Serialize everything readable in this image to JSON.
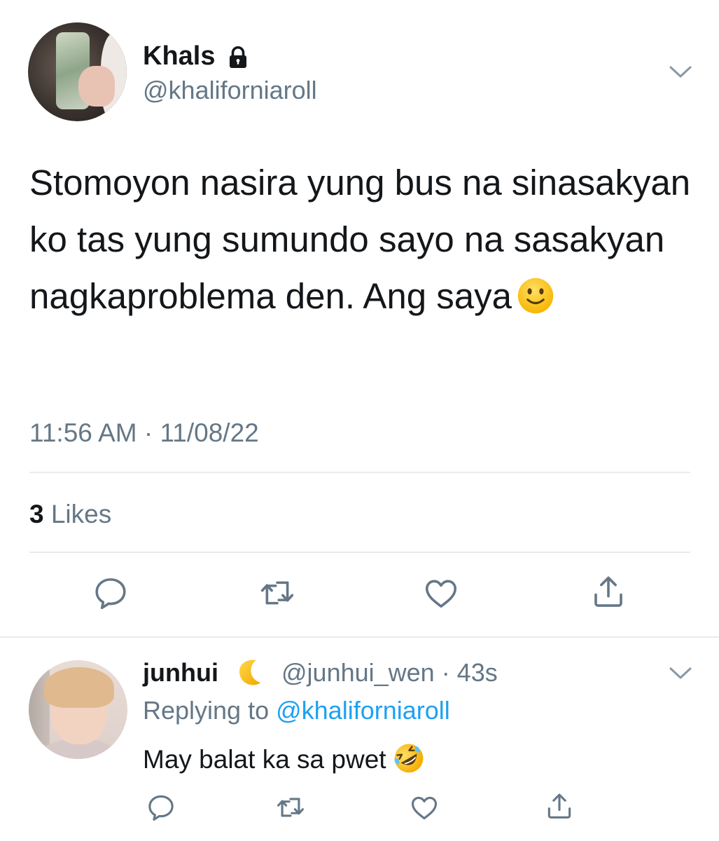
{
  "main_tweet": {
    "display_name": "Khals",
    "handle": "@khaliforniaroll",
    "text": "Stomoyon nasira yung bus na sinasakyan ko tas yung sumundo sayo na sasakyan nagkaproblema den. Ang saya",
    "text_emoji": "slightly-smiling-face-icon",
    "timestamp": "11:56 AM · 11/08/22",
    "likes_count": "3",
    "likes_label": "Likes",
    "icons": {
      "lock": "lock-icon",
      "menu": "chevron-down-icon",
      "actions": [
        "reply-icon",
        "retweet-icon",
        "like-icon",
        "share-icon"
      ]
    }
  },
  "reply": {
    "display_name": "junhui",
    "name_emoji": "crescent-moon-icon",
    "handle_time": "@junhui_wen · 43s",
    "replying_prefix": "Replying to ",
    "replying_handle": "@khaliforniaroll",
    "text": "May balat ka sa pwet",
    "text_emoji": "rolling-on-floor-laughing-icon",
    "icons": {
      "menu": "chevron-down-icon",
      "actions": [
        "reply-icon",
        "retweet-icon",
        "like-icon",
        "share-icon"
      ]
    }
  },
  "colors": {
    "text": "#14171a",
    "secondary": "#657786",
    "link": "#1da1f2",
    "divider": "#e6ecf0",
    "icon": "#657786"
  }
}
